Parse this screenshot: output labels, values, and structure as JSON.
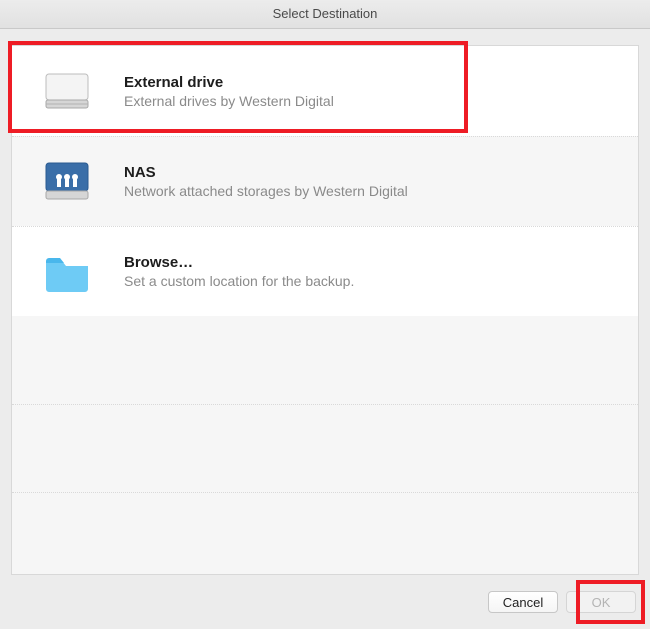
{
  "window": {
    "title": "Select Destination"
  },
  "list": {
    "items": [
      {
        "title": "External drive",
        "subtitle": "External drives by Western Digital",
        "icon": "external-drive-icon",
        "selected": true
      },
      {
        "title": "NAS",
        "subtitle": "Network attached storages by Western Digital",
        "icon": "nas-drive-icon",
        "selected": false
      },
      {
        "title": "Browse…",
        "subtitle": "Set a custom location for the backup.",
        "icon": "folder-icon",
        "selected": false
      }
    ]
  },
  "footer": {
    "cancel_label": "Cancel",
    "ok_label": "OK",
    "ok_enabled": false
  },
  "annotations": {
    "highlight_row_index": 0,
    "highlight_ok_button": true
  }
}
